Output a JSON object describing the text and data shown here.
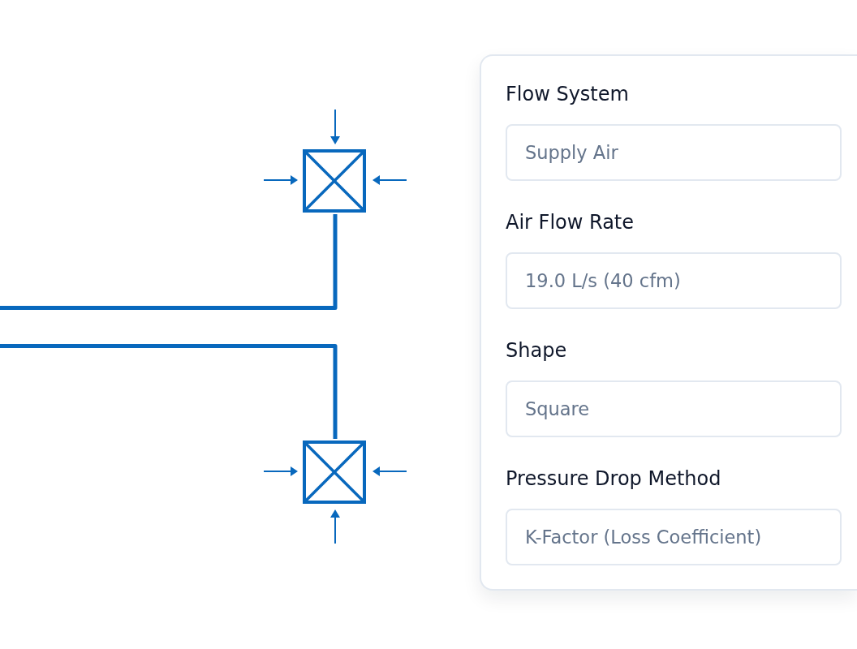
{
  "properties_panel": {
    "fields": [
      {
        "label": "Flow System",
        "value": "Supply Air"
      },
      {
        "label": "Air Flow Rate",
        "value": "19.0 L/s (40 cfm)"
      },
      {
        "label": "Shape",
        "value": "Square"
      },
      {
        "label": "Pressure Drop Method",
        "value": "K-Factor (Loss Coefficient)"
      }
    ]
  }
}
